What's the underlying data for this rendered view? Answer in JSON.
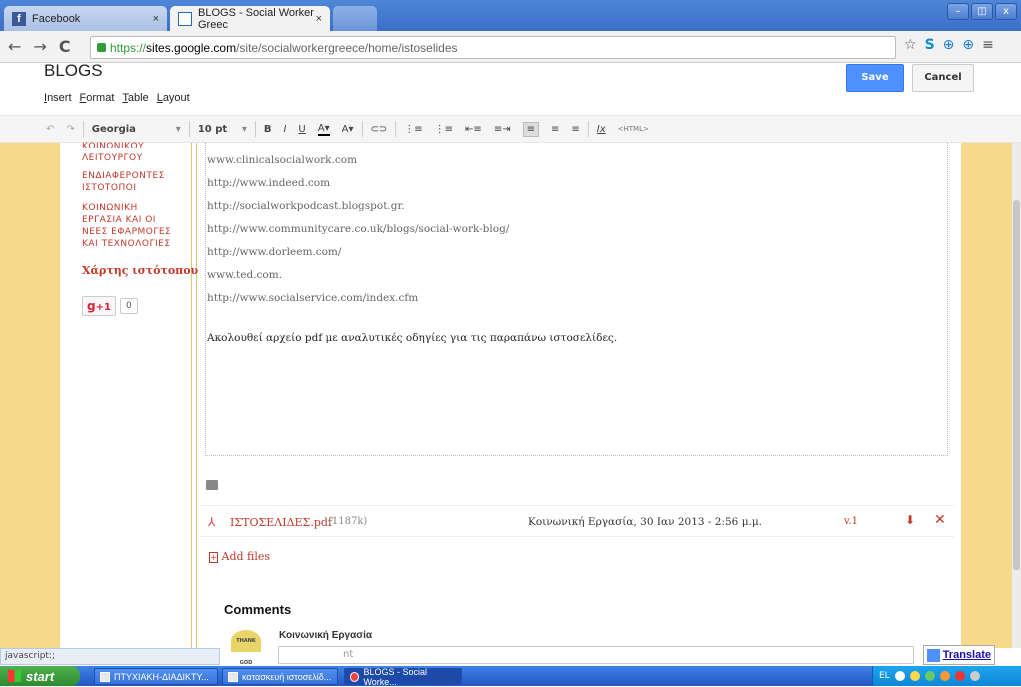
{
  "browser": {
    "tabs": [
      {
        "title": "Facebook",
        "close": "×"
      },
      {
        "title": "BLOGS - Social Worker Greec",
        "close": "×"
      }
    ],
    "window_controls": [
      "–",
      "◫",
      "x"
    ],
    "url": {
      "scheme": "https://",
      "host": "sites.google.com",
      "path": "/site/socialworkergreece/home/istoselides"
    },
    "nav": {
      "back": "←",
      "forward": "→",
      "reload": "C"
    },
    "right_icons": [
      "☆",
      "S",
      "⊕",
      "⊕",
      "≡"
    ]
  },
  "editor": {
    "title": "BLOGS",
    "menu": [
      {
        "first": "I",
        "rest": "nsert"
      },
      {
        "first": "F",
        "rest": "ormat"
      },
      {
        "first": "T",
        "rest": "able"
      },
      {
        "first": "L",
        "rest": "ayout"
      }
    ],
    "save_label": "Save",
    "cancel_label": "Cancel",
    "toolbar": {
      "undo": "↶",
      "redo": "↷",
      "font": "Georgia",
      "font_arrow": "▾",
      "size": "10 pt",
      "size_arrow": "▾",
      "bold": "B",
      "italic": "I",
      "underline": "U",
      "text_color": "A▾",
      "highlight": "A▾",
      "link": "⊂⊃",
      "numbered_list": "⋮≡",
      "bullet_list": "⋮≡",
      "indent_less": "⇤≡",
      "indent_more": "≡⇥",
      "align_left": "≡",
      "align_center": "≡",
      "align_right": "≡",
      "clear_format": "Ix",
      "html": "<HTML>"
    }
  },
  "sidebar": {
    "nav_items": [
      "ΚΟΙΝΩΝΙΚΟΥ",
      "ΛΕΙΤΟΥΡΓΟΥ",
      "ΕΝΔΙΑΦΕΡΟΝΤΕΣ",
      "ΙΣΤΟΤΟΠΟΙ",
      "ΚΟΙΝΩΝΙΚΗ",
      "ΕΡΓΑΣΙΑ ΚΑΙ ΟΙ",
      "ΝΕΕΣ ΕΦΑΡΜΟΓΕΣ",
      "ΚΑΙ ΤΕΧΝΟΛΟΓΙΕΣ"
    ],
    "sitemap": "Χάρτης ιστότοπου",
    "gplus_label": "+1",
    "gplus_count": "0"
  },
  "content": {
    "links": [
      "www.clinicalsocialwork.com",
      "http://www.indeed.com",
      "http://socialworkpodcast.blogspot.gr.",
      "http://www.communitycare.co.uk/blogs/social-work-blog/",
      "http://www.dorleem.com/",
      "www.ted.com.",
      "http://www.socialservice.com/index.cfm"
    ],
    "description": "Ακολουθεί αρχείο pdf με αναλυτικές οδηγίες για τις παραπάνω ιστοσελίδες."
  },
  "attachment": {
    "filename": "ΙΣΤΟΣΕΛΙΔΕΣ.pdf",
    "size": "(1187k)",
    "author_date": "Κοινωνική Εργασία, 30 Ιαν 2013 - 2:56 μ.μ.",
    "version": "v.1",
    "add_files": "Add files"
  },
  "comments": {
    "heading": "Comments",
    "commenter": "Κοινωνική Εργασία",
    "avatar_text": "THANK GOD",
    "input_partial": "nt"
  },
  "status": {
    "text": "javascript:;"
  },
  "translate": {
    "label": "Translate"
  },
  "taskbar": {
    "start": "start",
    "tasks": [
      "ΠΤΥΧΙΑΚΗ-ΔΙΑΔΙΚΤΥ...",
      "κατασκευή ιστοσελίδ...",
      "BLOGS - Social Worke..."
    ],
    "tray_lang": "EL"
  }
}
